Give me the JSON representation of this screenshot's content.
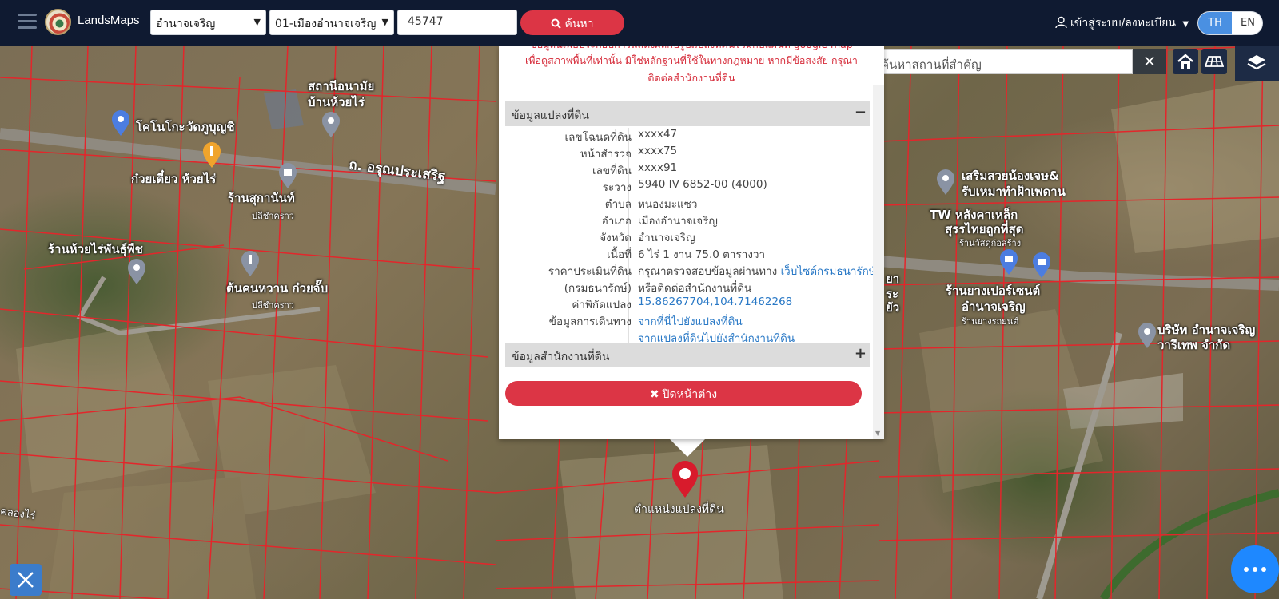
{
  "navbar": {
    "brand": "LandsMaps",
    "province_select": "อำนาจเจริญ",
    "amphoe_select": "01-เมืองอำนาจเจริญ",
    "parcel_number": "45747",
    "search_label": "ค้นหา",
    "login_label": "เข้าสู่ระบบ/ลงทะเบียน",
    "lang_th": "TH",
    "lang_en": "EN"
  },
  "map": {
    "place_search_placeholder": "ค้นหาสถานที่สำคัญ",
    "marker_label": "ตำแหน่งแปลงที่ดิน",
    "labels": {
      "health_center_1": "สถานีอนามัย",
      "health_center_2": "บ้านห้วยไร่",
      "kokanoko": "โคโนโกะ",
      "wat": "วัดภูบุญชิ",
      "noodle": "ก๋วยเตี๋ยว ห้วยไร่",
      "road": "ถ. อรุณประเสริฐ",
      "shop_sukanan": "ร้านสุกานันท์",
      "pak_shop": "ปลีชำคราว",
      "huaysai_shop": "ร้านห้วยไร่พันธุ์พืช",
      "tonkhon_1": "ต้นคนหวาน ก๋วยจั๊บ",
      "tonkhon_2": "ปลีชำคราว",
      "beauty_1": "เสริมสวยน้องเจษ&",
      "beauty_2": "รับเหมาทำฝ้าเพดาน",
      "tw_1": "TW หลังคาเหล็ก",
      "tw_2": "สุรรไทยถูกที่สุด",
      "tw_3": "ร้านวัสดุก่อสร้าง",
      "tyre_1": "ร้านยางเปอร์เซนต์",
      "tyre_2": "อำนาจเจริญ",
      "tyre_3": "ร้านยางรถยนต์",
      "company_1": "บริษัท อำนาจเจริญ",
      "company_2": "วารีเทพ จำกัด",
      "canal": "คลองไร่",
      "partial_1": "ยา",
      "partial_2": "ระ",
      "partial_3": "ยัว"
    }
  },
  "popup": {
    "disclaimer_line0": "ข้อมูลนี้เพื่อประกอบการแสดงผลกับรูปแปลงที่ดินร่วมกับแผนที่ google map",
    "disclaimer_line1": "เพื่อดูสภาพพื้นที่เท่านั้น มิใช่หลักฐานที่ใช้ในทางกฎหมาย หากมีข้อสงสัย กรุณา",
    "disclaimer_line2": "ติดต่อสำนักงานที่ดิน",
    "section_parcel": "ข้อมูลแปลงที่ดิน",
    "section_parcel_toggle": "−",
    "section_office": "ข้อมูลสำนักงานที่ดิน",
    "section_office_toggle": "+",
    "close_label": "ปิดหน้าต่าง",
    "rows": [
      {
        "k": "เลขโฉนดที่ดิน",
        "v": "xxxx47"
      },
      {
        "k": "หน้าสำรวจ",
        "v": "xxxx75"
      },
      {
        "k": "เลขที่ดิน",
        "v": "xxxx91"
      },
      {
        "k": "ระวาง",
        "v": "5940 IV 6852-00 (4000)"
      },
      {
        "k": "ตำบล",
        "v": "หนองมะแซว"
      },
      {
        "k": "อำเภอ",
        "v": "เมืองอำนาจเจริญ"
      },
      {
        "k": "จังหวัด",
        "v": "อำนาจเจริญ"
      },
      {
        "k": "เนื้อที่",
        "v": "6 ไร่ 1 งาน 75.0 ตารางวา"
      }
    ],
    "appraisal_key_1": "ราคาประเมินที่ดิน",
    "appraisal_key_2": "(กรมธนารักษ์)",
    "appraisal_text": "กรุณาตรวจสอบข้อมูลผ่านทาง",
    "appraisal_link": "เว็บไซต์กรมธนารักษ์",
    "appraisal_text_2": "หรือติดต่อสำนักงานที่ดิน",
    "coord_key": "ค่าพิกัดแปลง",
    "coord_value": "15.86267704,104.71462268",
    "travel_key": "ข้อมูลการเดินทาง",
    "travel_link_1": "จากที่นี่ไปยังแปลงที่ดิน",
    "travel_link_2": "จากแปลงที่ดินไปยังสำนักงานที่ดิน"
  }
}
